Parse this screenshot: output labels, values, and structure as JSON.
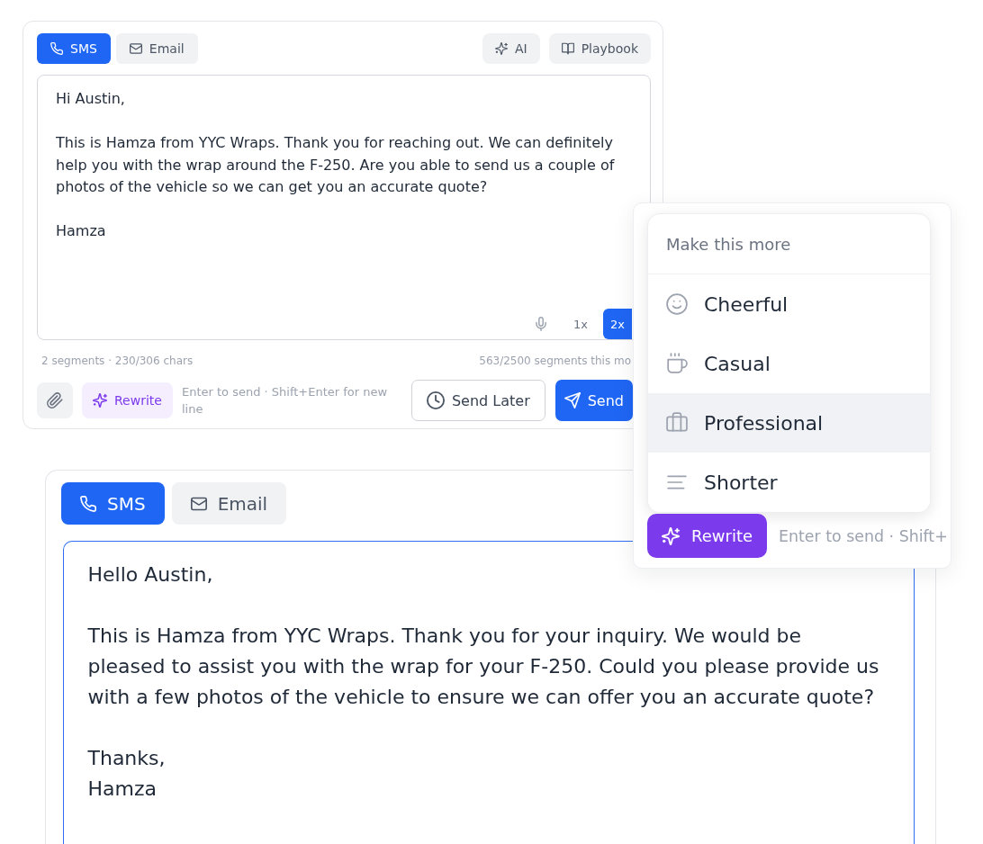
{
  "composer": {
    "tabs": [
      {
        "label": "SMS",
        "kind": "sms",
        "selected": true
      },
      {
        "label": "Email",
        "kind": "email",
        "selected": false
      }
    ],
    "tools": [
      {
        "label": "AI",
        "kind": "ai"
      },
      {
        "label": "Playbook",
        "kind": "playbook"
      }
    ],
    "message": {
      "focused": false,
      "paragraphs": [
        "Hi Austin,",
        "This is Hamza from YYC Wraps. Thank you for reaching out. We can definitely help you with the wrap around the F-250. Are you able to send us a couple of photos of the vehicle so we can get you an accurate quote?",
        "Hamza"
      ]
    },
    "speeds": [
      {
        "label": "1x",
        "selected": false
      },
      {
        "label": "2x",
        "selected": true
      }
    ],
    "segments": "2 segments · 230/306 chars",
    "usage": "563/2500 segments this mo",
    "rewrite_button": "Rewrite",
    "hint": "Enter to send · Shift+Enter for new line",
    "send_later_button": "Send Later",
    "send_button": "Send"
  },
  "rewrite_popup": {
    "menu": {
      "title": "Make this more",
      "options": [
        {
          "label": "Cheerful",
          "kind": "cheerful",
          "highlighted": false
        },
        {
          "label": "Casual",
          "kind": "casual",
          "highlighted": false
        },
        {
          "label": "Professional",
          "kind": "professional",
          "highlighted": true
        },
        {
          "label": "Shorter",
          "kind": "shorter",
          "highlighted": false
        }
      ]
    },
    "rewrite_button": "Rewrite",
    "hint": "Enter to send · Shift+"
  },
  "composer_zoomed": {
    "tabs": [
      {
        "label": "SMS",
        "kind": "sms",
        "selected": true
      },
      {
        "label": "Email",
        "kind": "email",
        "selected": false
      }
    ],
    "message": {
      "focused": true,
      "paragraphs": [
        "Hello Austin,",
        "This is Hamza from YYC Wraps. Thank you for your inquiry. We would be pleased to assist you with the wrap for your F-250. Could you please provide us with a few photos of the vehicle to ensure we can offer you an accurate quote?",
        "Thanks,\nHamza"
      ]
    }
  }
}
